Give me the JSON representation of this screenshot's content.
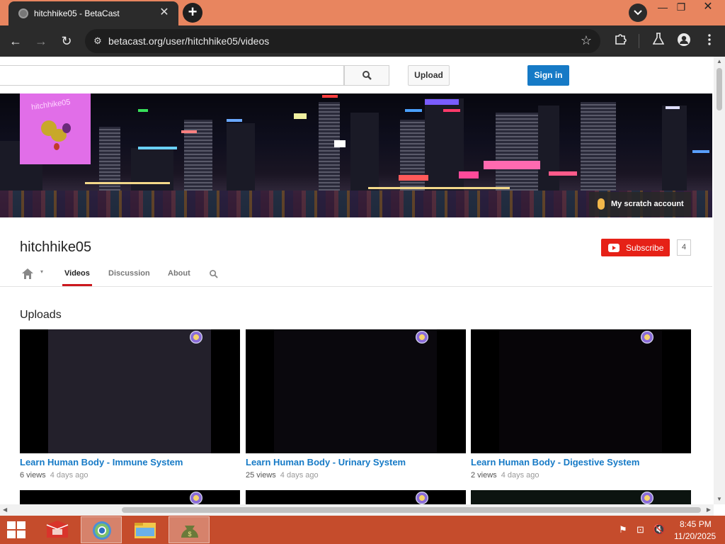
{
  "browser": {
    "tab_title": "hitchhike05 - BetaCast",
    "tab_close": "✕",
    "new_tab": "+",
    "url": "betacast.org/user/hitchhike05/videos",
    "window_controls": {
      "minimize": "—",
      "maximize": "❐",
      "close": "✕"
    },
    "nav": {
      "back": "←",
      "forward": "→",
      "reload": "↻",
      "star": "☆"
    }
  },
  "masthead": {
    "search_placeholder": "",
    "upload_label": "Upload",
    "signin_label": "Sign in",
    "signin_color": "#167ac6"
  },
  "banner": {
    "avatar_text": "hitchhike05",
    "scratch_link": "My scratch account"
  },
  "channel": {
    "title": "hitchhike05",
    "subscribe_label": "Subscribe",
    "subscriber_count": "4",
    "subscribe_color": "#e62117"
  },
  "nav": {
    "tabs": [
      "Videos",
      "Discussion",
      "About"
    ],
    "active": "Videos",
    "home_caret": "▾"
  },
  "uploads": {
    "heading": "Uploads",
    "videos": [
      {
        "title": "Learn Human Body - Immune System",
        "views": "6 views",
        "age": "4 days ago"
      },
      {
        "title": "Learn Human Body - Urinary System",
        "views": "25 views",
        "age": "4 days ago"
      },
      {
        "title": "Learn Human Body - Digestive System",
        "views": "2 views",
        "age": "4 days ago"
      }
    ]
  },
  "taskbar": {
    "time": "8:45 PM",
    "date": "11/20/2025",
    "apps": [
      "file-manager-red",
      "chrome",
      "file-explorer",
      "money-app"
    ],
    "active_app": "chrome"
  },
  "colors": {
    "titlebar": "#e8855f",
    "taskbar": "#c54c2c",
    "link": "#167ac6"
  }
}
